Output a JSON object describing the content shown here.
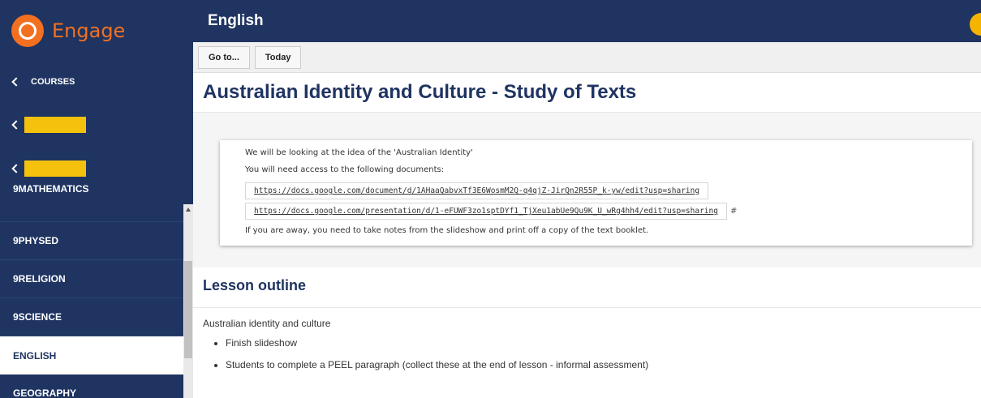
{
  "app": {
    "logo_text": "Engage"
  },
  "sidebar": {
    "courses_label": "COURSES",
    "subjects": [
      {
        "label": "9MATHEMATICS"
      },
      {
        "label": "9PHYSED"
      },
      {
        "label": "9RELIGION"
      },
      {
        "label": "9SCIENCE"
      },
      {
        "label": "ENGLISH"
      },
      {
        "label": "GEOGRAPHY"
      }
    ],
    "active_subject": "ENGLISH"
  },
  "header": {
    "title": "English"
  },
  "toolbar": {
    "goto_label": "Go to...",
    "today_label": "Today"
  },
  "page": {
    "title": "Australian Identity and Culture - Study of Texts",
    "card": {
      "line1": "We will be looking at the idea of the 'Australian Identity'",
      "line2": "You will need access to the following documents:",
      "link1": "https://docs.google.com/document/d/1AHaaQabvxTf3E6WosmM2Q-q4qjZ-JirQn2R55P_k-yw/edit?usp=sharing",
      "link2": "https://docs.google.com/presentation/d/1-eFUWF3zo1sptDYf1_TjXeu1abUe9Qu9K_U_wRg4hh4/edit?usp=sharing",
      "hash": "#",
      "line3": "If you are away, you need to take notes from the slideshow and print off a copy of the text booklet."
    },
    "lesson_outline": {
      "heading": "Lesson outline",
      "intro": "Australian identity and culture",
      "items": [
        "Finish slideshow",
        "Students to complete a PEEL paragraph (collect these at the end of lesson - informal assessment)"
      ]
    }
  },
  "colors": {
    "navy": "#1f3461",
    "orange": "#f37021",
    "highlight": "#f4c20d"
  }
}
